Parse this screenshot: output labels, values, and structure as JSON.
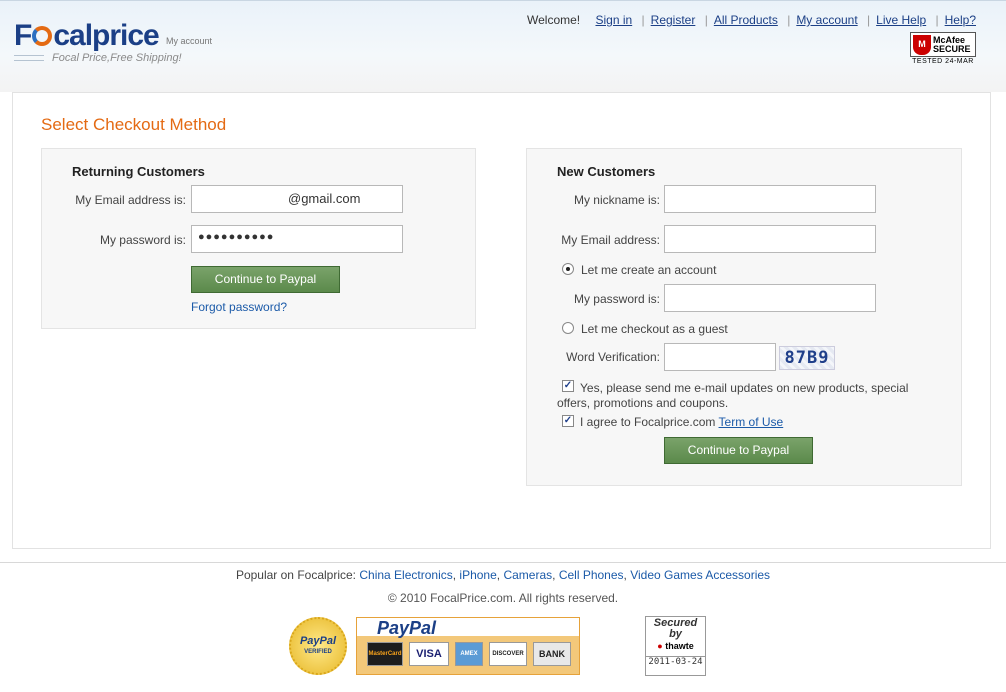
{
  "header": {
    "logo_pre": "F",
    "logo_post": "calprice",
    "logo_sub": "My account",
    "tagline": "Focal Price,Free Shipping!",
    "welcome": "Welcome!",
    "nav": [
      "Sign in",
      "Register",
      "All Products",
      "My account",
      "Live Help",
      "Help?"
    ],
    "mcafee_brand": "McAfee",
    "mcafee_secure": "SECURE",
    "mcafee_tested": "TESTED 24-MAR"
  },
  "checkout": {
    "title": "Select Checkout Method",
    "returning": {
      "heading": "Returning Customers",
      "email_label": "My Email address is:",
      "email_value": "@gmail.com",
      "password_label": "My password is:",
      "password_value": "●●●●●●●●●●",
      "continue_label": "Continue to Paypal",
      "forgot_label": "Forgot password?"
    },
    "new": {
      "heading": "New Customers",
      "nickname_label": "My nickname is:",
      "email_label": "My Email address:",
      "create_account_label": "Let me create an account",
      "password_label": "My password is:",
      "guest_label": "Let me checkout as a guest",
      "verification_label": "Word Verification:",
      "captcha_text": "87B9",
      "updates_line1": "Yes, please send me e-mail updates on new products, special",
      "updates_line2": "offers, promotions and coupons.",
      "agree_label": "I agree to Focalprice.com",
      "terms_label": "Term of Use",
      "continue_label": "Continue to Paypal"
    }
  },
  "footer": {
    "popular_prefix": "Popular on Focalprice:",
    "popular_links": [
      "China Electronics",
      "iPhone",
      "Cameras",
      "Cell Phones",
      "Video Games Accessories"
    ],
    "copyright": "© 2010 FocalPrice.com. All rights reserved.",
    "paypal_verified_1": "PayPal",
    "paypal_verified_2": "VERIFIED",
    "paypal_title": "PayPal",
    "cards": [
      "MasterCard",
      "VISA",
      "AMEX",
      "DISCOVER",
      "BANK"
    ],
    "thawte_1": "Secured",
    "thawte_2": "by",
    "thawte_3": "thawte",
    "thawte_date": "2011-03-24"
  }
}
